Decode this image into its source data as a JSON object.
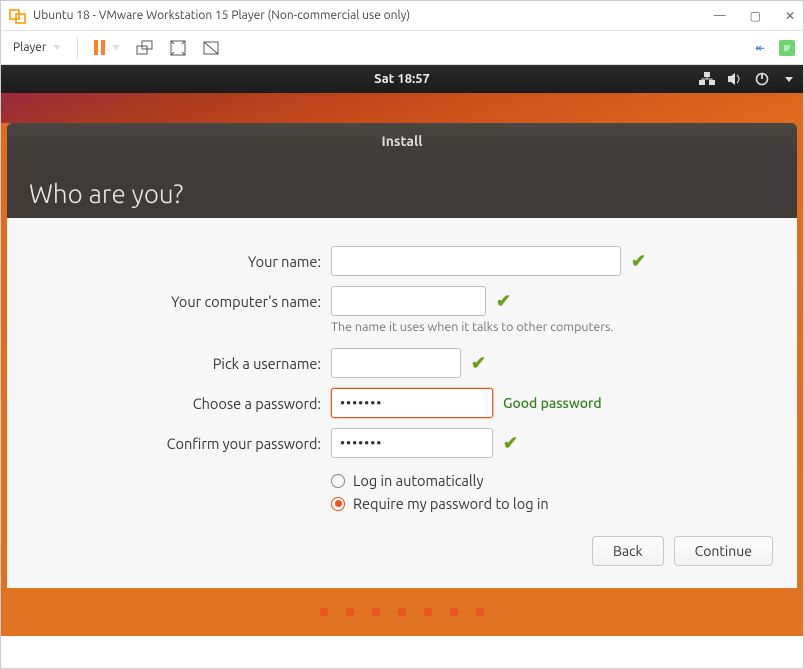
{
  "vmware": {
    "window_title": "Ubuntu 18 - VMware Workstation 15 Player (Non-commercial use only)",
    "player_menu": "Player",
    "back_glyph": "↞"
  },
  "ubuntu_topbar": {
    "clock": "Sat 18:57"
  },
  "installer": {
    "window_title": "Install",
    "heading": "Who are you?",
    "labels": {
      "your_name": "Your name:",
      "computer_name": "Your computer's name:",
      "computer_hint": "The name it uses when it talks to other computers.",
      "username": "Pick a username:",
      "password": "Choose a password:",
      "confirm": "Confirm your password:"
    },
    "values": {
      "your_name": "",
      "computer_name": "",
      "username": "",
      "password": "•••••••",
      "confirm": "•••••••"
    },
    "password_feedback": "Good password",
    "radios": {
      "auto": "Log in automatically",
      "require": "Require my password to log in"
    },
    "buttons": {
      "back": "Back",
      "continue": "Continue"
    }
  }
}
